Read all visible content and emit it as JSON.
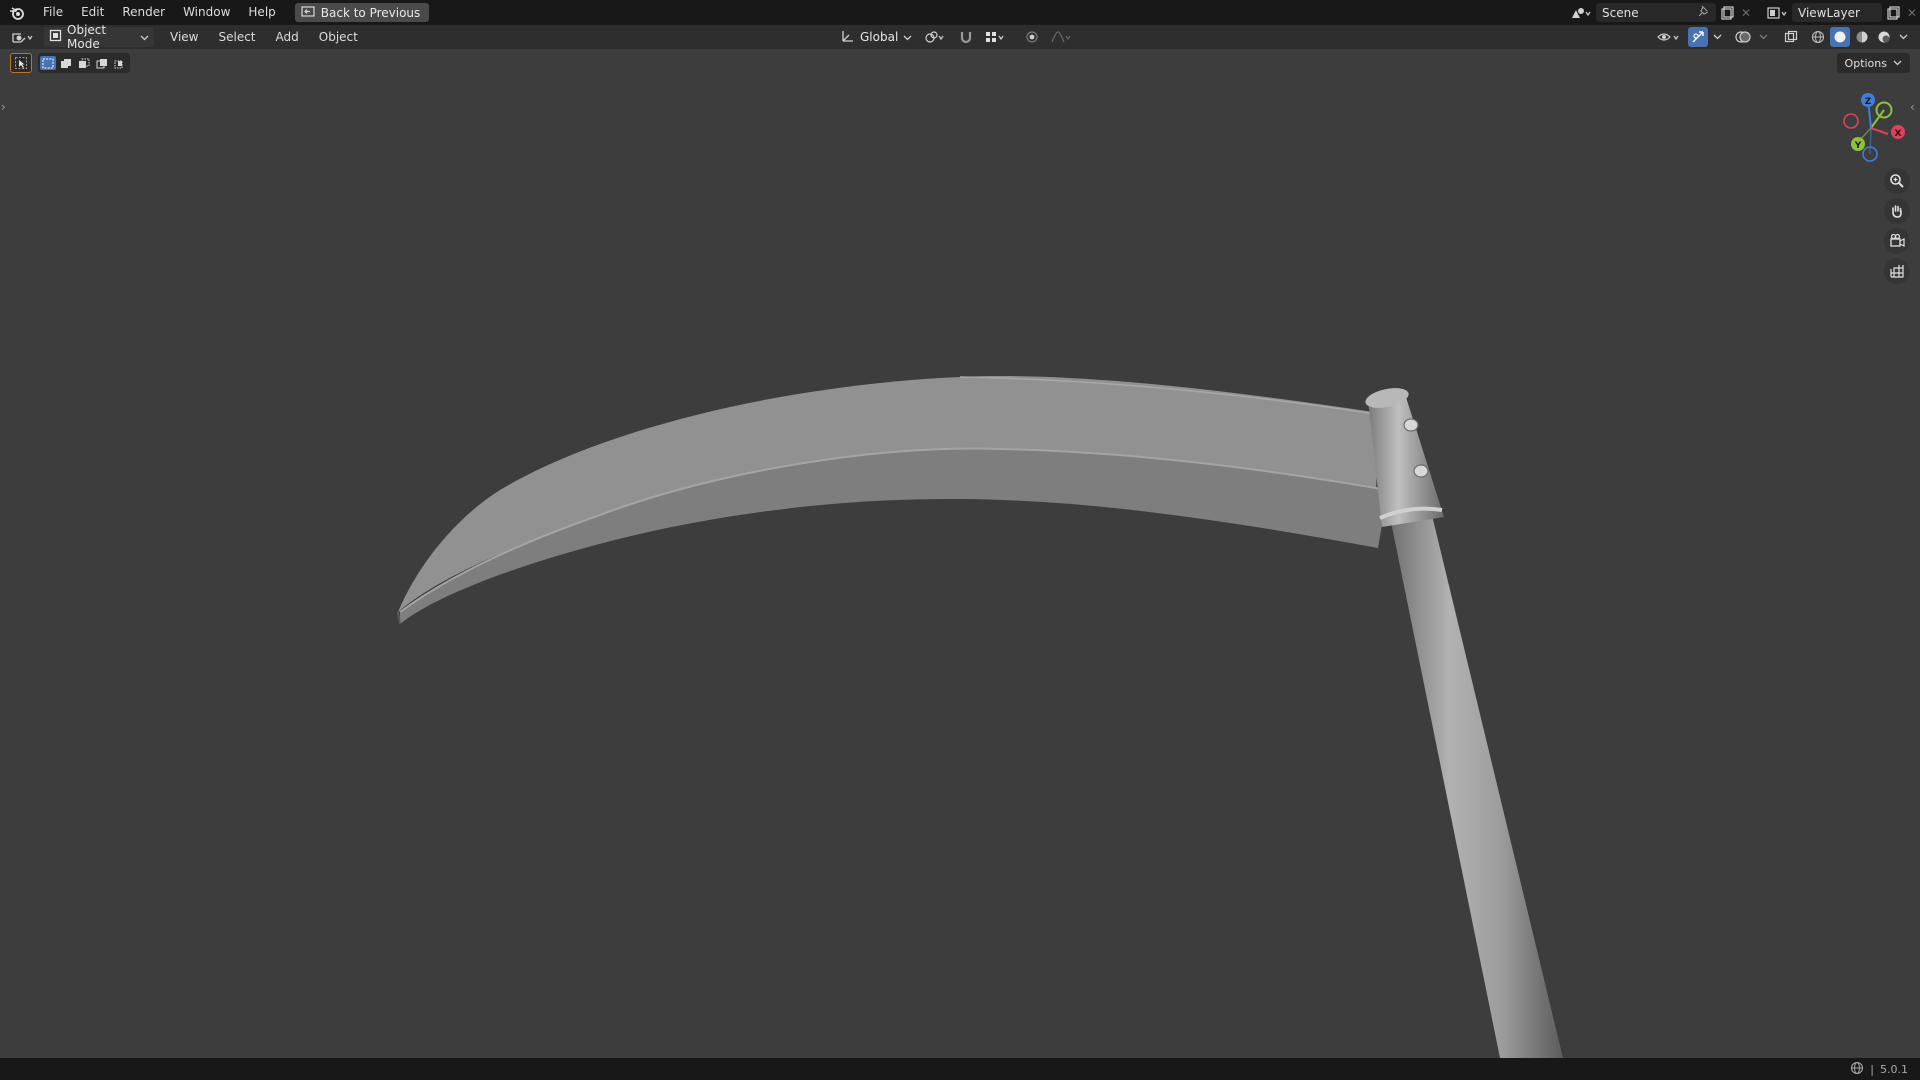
{
  "topbar": {
    "menu": [
      "File",
      "Edit",
      "Render",
      "Window",
      "Help"
    ],
    "back_button": "Back to Previous",
    "scene_name": "Scene",
    "view_layer": "ViewLayer"
  },
  "header": {
    "mode": "Object Mode",
    "menus": [
      "View",
      "Select",
      "Add",
      "Object"
    ],
    "transform_orientation": "Global"
  },
  "viewport": {
    "options_label": "Options",
    "gizmo_axes": [
      "Z",
      "Y",
      "X"
    ]
  },
  "statusbar": {
    "version": "5.0.1"
  },
  "colors": {
    "axis_x": "#e0415a",
    "axis_y": "#8fc13a",
    "axis_z": "#3d7fd9",
    "accent": "#4772b3"
  }
}
